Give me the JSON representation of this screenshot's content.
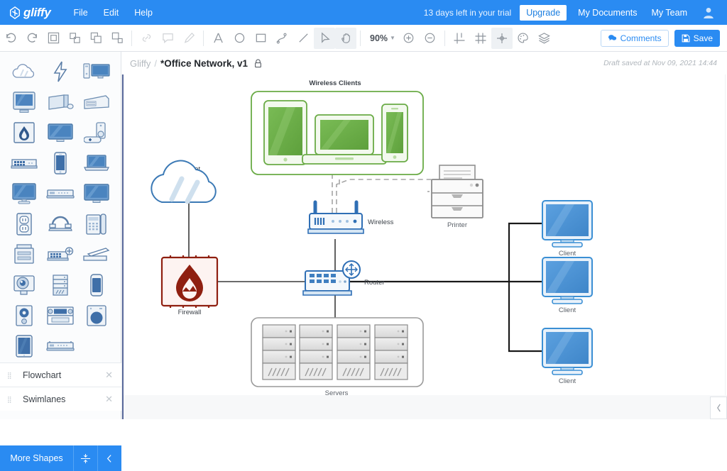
{
  "app": {
    "brand": "gliffy",
    "menus": [
      "File",
      "Edit",
      "Help"
    ],
    "trial_text": "13 days left in your trial",
    "upgrade_label": "Upgrade",
    "my_documents_label": "My Documents",
    "my_team_label": "My Team",
    "accent_color": "#2a8bf2"
  },
  "toolbar": {
    "zoom_level": "90%",
    "comments_label": "Comments",
    "save_label": "Save",
    "tools": [
      {
        "name": "undo-icon",
        "enabled": true
      },
      {
        "name": "redo-icon",
        "enabled": true
      },
      {
        "name": "group-icon",
        "enabled": true
      },
      {
        "name": "ungroup-icon",
        "enabled": true
      },
      {
        "name": "bring-to-front-icon",
        "enabled": true
      },
      {
        "name": "send-to-back-icon",
        "enabled": true
      },
      {
        "name": "link-icon",
        "enabled": false
      },
      {
        "name": "comment-icon",
        "enabled": false
      },
      {
        "name": "format-painter-icon",
        "enabled": false
      },
      {
        "name": "text-icon",
        "enabled": true
      },
      {
        "name": "ellipse-icon",
        "enabled": true
      },
      {
        "name": "rectangle-icon",
        "enabled": true
      },
      {
        "name": "connector-icon",
        "enabled": true
      },
      {
        "name": "line-icon",
        "enabled": true
      },
      {
        "name": "pointer-icon",
        "enabled": true
      },
      {
        "name": "hand-icon",
        "enabled": true
      },
      {
        "name": "zoom-in-icon",
        "enabled": true
      },
      {
        "name": "zoom-out-icon",
        "enabled": true
      },
      {
        "name": "guides-icon",
        "enabled": true
      },
      {
        "name": "grid-icon",
        "enabled": true
      },
      {
        "name": "snap-icon",
        "enabled": true
      },
      {
        "name": "theme-icon",
        "enabled": true
      },
      {
        "name": "layers-icon",
        "enabled": true
      }
    ]
  },
  "palette": {
    "shapes": [
      "cloud-shape",
      "lightning-shape",
      "desktop-tower-shape",
      "crt-monitor-shape",
      "tower-mouse-shape",
      "printer-mfp-shape",
      "firewall-shape",
      "flat-monitor-shape",
      "game-console-shape",
      "switch-shape",
      "smartphone-shape",
      "laptop-shape",
      "monitor-stand-shape",
      "router-shape",
      "widescreen-monitor-shape",
      "power-outlet-shape",
      "telephone-shape",
      "desk-phone-shape",
      "multifunction-printer-shape",
      "wireless-switch-shape",
      "scanner-shape",
      "projector-shape",
      "server-rack-shape",
      "mobile-phone-shape",
      "speaker-shape",
      "av-receiver-shape",
      "washer-shape",
      "tablet-shape",
      "modem-shape"
    ],
    "sections": [
      {
        "label": "Flowchart"
      },
      {
        "label": "Swimlanes"
      }
    ],
    "more_shapes_label": "More Shapes",
    "collapse_all_icon": "collapse-all-icon",
    "hide_panel_icon": "chevron-left-icon"
  },
  "document": {
    "breadcrumb_root": "Gliffy",
    "breadcrumb_separator": "/",
    "title": "*Office Network, v1",
    "lock_icon": "lock-icon",
    "draft_status": "Draft saved at Nov 09, 2021 14:44"
  },
  "diagram": {
    "title": "Office Network",
    "groups": [
      {
        "name": "wireless-clients-group",
        "label": "Wireless Clients",
        "border_color": "#6aab46",
        "members": [
          "tablet",
          "laptop",
          "smartphone"
        ]
      },
      {
        "name": "servers-group",
        "label": "Servers",
        "border_color": "#9a9a9a",
        "members": [
          "server-rack",
          "server-rack",
          "server-rack",
          "server-rack"
        ]
      }
    ],
    "nodes": [
      {
        "name": "internet-node",
        "label": "Internet",
        "shape": "cloud",
        "color": "#3b79b5"
      },
      {
        "name": "firewall-node",
        "label": "Firewall",
        "shape": "firewall",
        "color": "#8f1f10"
      },
      {
        "name": "wireless-node",
        "label": "Wireless",
        "shape": "access-point",
        "color": "#2f6fb5"
      },
      {
        "name": "router-node",
        "label": "Router",
        "shape": "switch",
        "color": "#2f6fb5",
        "selected": true
      },
      {
        "name": "printer-node",
        "label": "Printer",
        "shape": "printer",
        "color": "#8a8a8a"
      },
      {
        "name": "client-node-1",
        "label": "Client",
        "shape": "monitor",
        "color": "#3b8fd4"
      },
      {
        "name": "client-node-2",
        "label": "Client",
        "shape": "monitor",
        "color": "#3b8fd4"
      },
      {
        "name": "client-node-3",
        "label": "Client",
        "shape": "monitor",
        "color": "#3b8fd4"
      }
    ],
    "connections": [
      {
        "from": "internet-node",
        "to": "firewall-node",
        "style": "solid"
      },
      {
        "from": "firewall-node",
        "to": "router-node",
        "style": "solid"
      },
      {
        "from": "router-node",
        "to": "wireless-node",
        "style": "solid"
      },
      {
        "from": "router-node",
        "to": "servers-group",
        "style": "solid"
      },
      {
        "from": "router-node",
        "to": "client-node-1",
        "style": "solid"
      },
      {
        "from": "router-node",
        "to": "client-node-2",
        "style": "solid"
      },
      {
        "from": "router-node",
        "to": "client-node-3",
        "style": "solid"
      },
      {
        "from": "wireless-node",
        "to": "wireless-clients-group",
        "style": "dashed"
      },
      {
        "from": "wireless-node",
        "to": "printer-node",
        "style": "dashed"
      }
    ]
  },
  "footer": {
    "expand_tab_icon": "chevron-left-icon"
  }
}
